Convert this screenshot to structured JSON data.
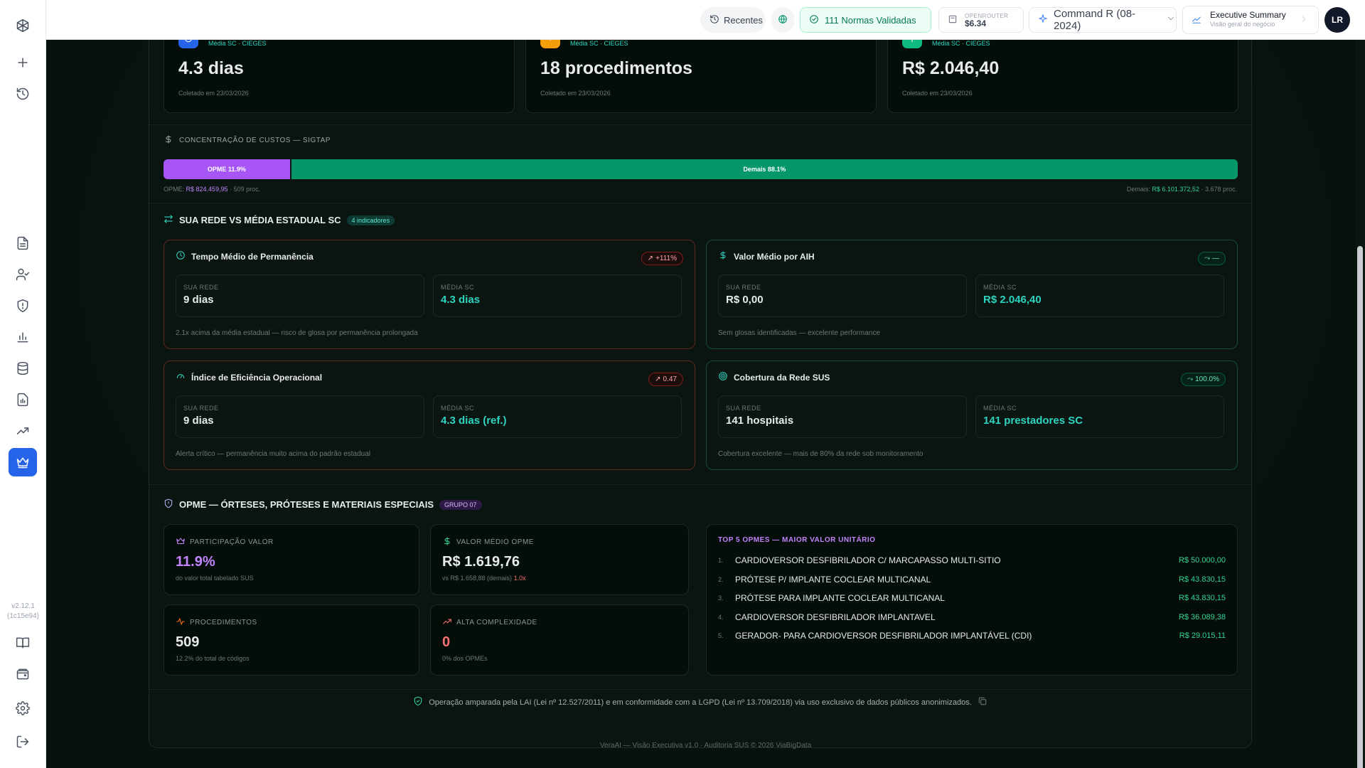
{
  "app": {
    "version_line1": "v2.12.1",
    "version_line2": "(1c15e94)"
  },
  "topbar": {
    "recent_label": "Recentes",
    "norms_label": "111 Normas Validadas",
    "openrouter_label": "OPENROUTER",
    "openrouter_value": "$6.34",
    "model_label": "Command R (08-2024)",
    "view_title": "Executive Summary",
    "view_subtitle": "Visão geral do negócio",
    "avatar": "LR"
  },
  "kpis": [
    {
      "source": "Média SC · CIEGES",
      "value": "4.3 dias",
      "collected": "Coletado em 23/03/2026",
      "color": "#3b82f6"
    },
    {
      "source": "Média SC · CIEGES",
      "value": "18 procedimentos",
      "collected": "Coletado em 23/03/2026",
      "color": "#f59e0b"
    },
    {
      "source": "Média SC · CIEGES",
      "value": "R$ 2.046,40",
      "collected": "Coletado em 23/03/2026",
      "color": "#10b981"
    }
  ],
  "cost_concentration": {
    "title": "CONCENTRAÇÃO DE CUSTOS — SIGTAP",
    "opme_label": "OPME 11.9%",
    "opme_share": 0.119,
    "rest_label": "Demais 88.1%",
    "opme_prefix": "OPME:",
    "opme_value": "R$ 824.459,95",
    "opme_count": "· 509 proc.",
    "rest_prefix": "Demais:",
    "rest_value": "R$ 6.101.372,52",
    "rest_count": "· 3.678 proc."
  },
  "comparison": {
    "title": "SUA REDE VS MÉDIA ESTADUAL SC",
    "chip": "4 indicadores",
    "cards": [
      {
        "title": "Tempo Médio de Permanência",
        "badge": "+111%",
        "left_label": "SUA REDE",
        "left_value": "9 dias",
        "right_label": "MÉDIA SC",
        "right_value": "4.3 dias",
        "note": "2.1x acima da média estadual — risco de glosa por permanência prolongada"
      },
      {
        "title": "Valor Médio por AIH",
        "badge": "—",
        "left_label": "SUA REDE",
        "left_value": "R$ 0,00",
        "right_label": "MÉDIA SC",
        "right_value": "R$ 2.046,40",
        "note": "Sem glosas identificadas — excelente performance"
      },
      {
        "title": "Índice de Eficiência Operacional",
        "badge": "0.47",
        "left_label": "SUA REDE",
        "left_value": "9 dias",
        "right_label": "MÉDIA SC",
        "right_value": "4.3 dias (ref.)",
        "note": "Alerta crítico — permanência muito acima do padrão estadual"
      },
      {
        "title": "Cobertura da Rede SUS",
        "badge": "100.0%",
        "left_label": "SUA REDE",
        "left_value": "141 hospitais",
        "right_label": "MÉDIA SC",
        "right_value": "141 prestadores SC",
        "note": "Cobertura excelente — mais de 80% da rede sob monitoramento"
      }
    ]
  },
  "opme": {
    "title": "OPME — ÓRTESES, PRÓTESES E MATERIAIS ESPECIAIS",
    "chip": "GRUPO 07",
    "stats": [
      {
        "label": "PARTICIPAÇÃO VALOR",
        "value": "11.9%",
        "sub": "do valor total tabelado SUS"
      },
      {
        "label": "VALOR MÉDIO OPME",
        "value": "R$ 1.619,76",
        "sub": "vs R$ 1.658,88 (demais)",
        "sub_extra": "1.0x"
      },
      {
        "label": "PROCEDIMENTOS",
        "value": "509",
        "sub": "12.2% do total de códigos"
      },
      {
        "label": "ALTA COMPLEXIDADE",
        "value": "0",
        "sub": "0% dos OPMEs"
      }
    ],
    "top_title": "TOP 5 OPMES — MAIOR VALOR UNITÁRIO",
    "top": [
      {
        "rank": "1.",
        "name": "CARDIOVERSOR DESFIBRILADOR C/ MARCAPASSO MULTI-SITIO",
        "value": "R$ 50.000,00"
      },
      {
        "rank": "2.",
        "name": "PRÓTESE P/ IMPLANTE COCLEAR MULTICANAL",
        "value": "R$ 43.830,15"
      },
      {
        "rank": "3.",
        "name": "PRÓTESE PARA IMPLANTE COCLEAR MULTICANAL",
        "value": "R$ 43.830,15"
      },
      {
        "rank": "4.",
        "name": "CARDIOVERSOR DESFIBRILADOR IMPLANTAVEL",
        "value": "R$ 36.089,38"
      },
      {
        "rank": "5.",
        "name": "GERADOR- PARA CARDIOVERSOR DESFIBRILADOR IMPLANTÁVEL (CDI)",
        "value": "R$ 29.015,11"
      }
    ]
  },
  "footer": {
    "compliance": "Operação amparada pela LAI (Lei nº 12.527/2011) e em conformidade com a LGPD (Lei nº 13.709/2018) via uso exclusivo de dados públicos anonimizados.",
    "credits": "VeraAI — Visão Executiva v1.0 · Auditoria SUS © 2026 ViaBigData"
  }
}
